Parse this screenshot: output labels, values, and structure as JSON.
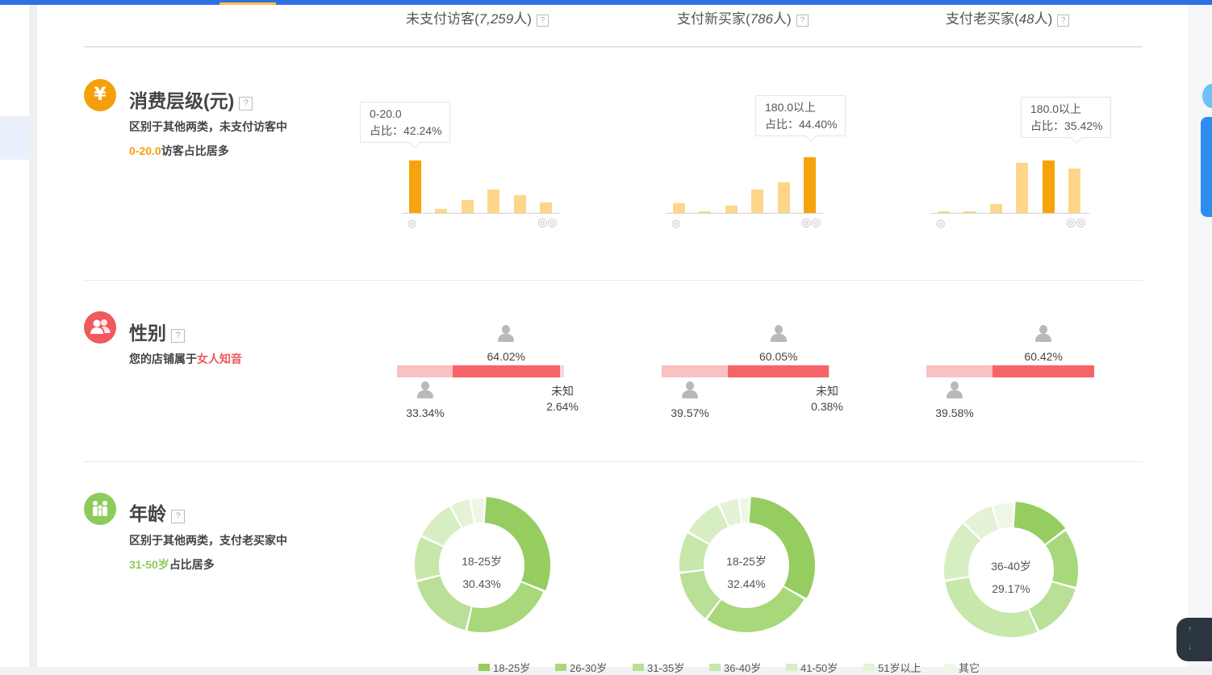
{
  "headers": [
    {
      "label": "未支付访客(",
      "count": "7,259",
      "suffix": "人)"
    },
    {
      "label": "支付新买家(",
      "count": "786",
      "suffix": "人)"
    },
    {
      "label": "支付老买家(",
      "count": "48",
      "suffix": "人)"
    }
  ],
  "help_glyph": "?",
  "sections": {
    "spend": {
      "title": "消费层级(元)",
      "icon": "yen-icon",
      "icon_glyph": "¥",
      "color": "#f5a00a",
      "desc_line1": "区别于其他两类，未支付访客中",
      "desc_highlight": "0-20.0",
      "desc_rest": "访客占比居多"
    },
    "gender": {
      "title": "性别",
      "icon": "users-icon",
      "color": "#f0595e",
      "desc_prefix": "您的店铺属于",
      "desc_highlight": "女人知音"
    },
    "age": {
      "title": "年龄",
      "icon": "family-icon",
      "color": "#8ecb5a",
      "desc_line1": "区别于其他两类，支付老买家中",
      "desc_highlight": "31-50岁",
      "desc_rest": "占比居多"
    }
  },
  "spend_tooltips": [
    {
      "range": "0-20.0",
      "share": "占比：42.24%"
    },
    {
      "range": "180.0以上",
      "share": "占比：44.40%"
    },
    {
      "range": "180.0以上",
      "share": "占比：35.42%"
    }
  ],
  "gender": [
    {
      "female_pct": "64.02%",
      "male_pct": "33.34%",
      "unknown_label": "未知",
      "unknown_pct": "2.64%"
    },
    {
      "female_pct": "60.05%",
      "male_pct": "39.57%",
      "unknown_label": "未知",
      "unknown_pct": "0.38%"
    },
    {
      "female_pct": "60.42%",
      "male_pct": "39.58%",
      "unknown_label": "",
      "unknown_pct": ""
    }
  ],
  "age_centers": [
    {
      "label": "18-25岁",
      "pct": "30.43%"
    },
    {
      "label": "18-25岁",
      "pct": "32.44%"
    },
    {
      "label": "36-40岁",
      "pct": "29.17%"
    }
  ],
  "age_legend": [
    "18-25岁",
    "26-30岁",
    "31-35岁",
    "36-40岁",
    "41-50岁",
    "51岁以上",
    "其它"
  ],
  "colors": {
    "highlight_bar": "#f7a30c",
    "light_bar": "#fdd68a",
    "female": "#f66468",
    "male": "#f8c1c2",
    "unknown": "#fbd7d8",
    "age_palette": [
      "#96cd60",
      "#a8d87a",
      "#b9e096",
      "#c8e7ab",
      "#d7eec3",
      "#e4f2d5",
      "#eef7e6"
    ]
  },
  "chart_data": [
    {
      "type": "bar",
      "segment": "未支付访客",
      "values": [
        42.24,
        3.5,
        10.5,
        18.5,
        14.5,
        8.5
      ]
    },
    {
      "type": "bar",
      "segment": "支付新买家",
      "values": [
        7.5,
        1.0,
        6.0,
        18.5,
        24.5,
        44.4
      ]
    },
    {
      "type": "bar",
      "segment": "支付老买家",
      "values": [
        1.5,
        1.5,
        7.0,
        40.0,
        42.0,
        35.42
      ]
    },
    {
      "type": "pie",
      "segment": "未支付访客",
      "values": [
        30.43,
        22.5,
        17.5,
        11.0,
        10.0,
        5.0,
        3.57
      ]
    },
    {
      "type": "pie",
      "segment": "支付新买家",
      "values": [
        32.44,
        27.0,
        13.0,
        10.0,
        10.0,
        5.0,
        2.56
      ]
    },
    {
      "type": "pie",
      "segment": "支付老买家",
      "values": [
        14.0,
        14.5,
        14.0,
        29.17,
        15.0,
        8.0,
        5.33
      ]
    }
  ]
}
